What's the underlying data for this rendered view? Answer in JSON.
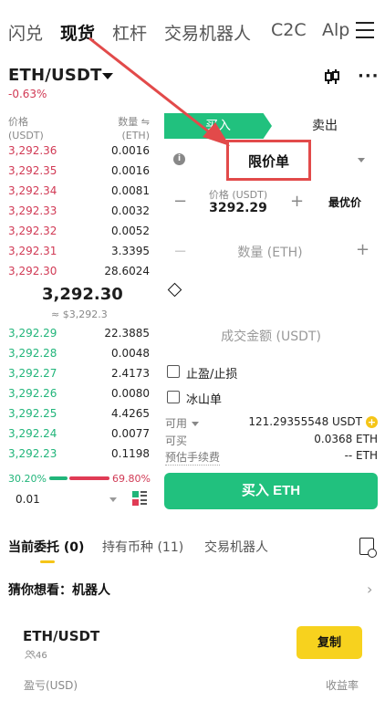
{
  "topnav": {
    "tabs": [
      {
        "label": "闪兑",
        "active": false
      },
      {
        "label": "现货",
        "active": true
      },
      {
        "label": "杠杆",
        "active": false
      },
      {
        "label": "交易机器人",
        "active": false
      },
      {
        "label": "C2C",
        "active": false
      },
      {
        "label": "Alp",
        "active": false
      }
    ],
    "menu_icon": "hamburger-menu-icon"
  },
  "pair": {
    "symbol": "ETH/USDT",
    "change": "-0.63%",
    "icons": [
      "candlestick-icon",
      "more-dots-icon"
    ]
  },
  "orderbook": {
    "price_header": "价格\n(USDT)",
    "price_header_line1": "价格",
    "price_header_line2": "(USDT)",
    "qty_header_line1": "数量 ⇋",
    "qty_header_line2": "(ETH)",
    "asks": [
      {
        "price": "3,292.36",
        "qty": "0.0016"
      },
      {
        "price": "3,292.35",
        "qty": "0.0016"
      },
      {
        "price": "3,292.34",
        "qty": "0.0081"
      },
      {
        "price": "3,292.33",
        "qty": "0.0032"
      },
      {
        "price": "3,292.32",
        "qty": "0.0052"
      },
      {
        "price": "3,292.31",
        "qty": "3.3395"
      },
      {
        "price": "3,292.30",
        "qty": "28.6024"
      }
    ],
    "last_price": "3,292.30",
    "last_price_usd": "≈ $3,292.3",
    "bids": [
      {
        "price": "3,292.29",
        "qty": "22.3885"
      },
      {
        "price": "3,292.28",
        "qty": "0.0048"
      },
      {
        "price": "3,292.27",
        "qty": "2.4173"
      },
      {
        "price": "3,292.26",
        "qty": "0.0080"
      },
      {
        "price": "3,292.25",
        "qty": "4.4265"
      },
      {
        "price": "3,292.24",
        "qty": "0.0077"
      },
      {
        "price": "3,292.23",
        "qty": "0.1198"
      }
    ],
    "buy_ratio": "30.20%",
    "sell_ratio": "69.80%",
    "precision": "0.01"
  },
  "order_form": {
    "buy_tab": "买入",
    "sell_tab": "卖出",
    "order_type": "限价单",
    "price_label": "价格 (USDT)",
    "price_value": "3292.29",
    "best_price": "最优价",
    "qty_placeholder": "数量 (ETH)",
    "amount_placeholder": "成交金额 (USDT)",
    "tp_sl": "止盈/止损",
    "iceberg": "冰山单",
    "available_label": "可用",
    "available_value": "121.29355548 USDT",
    "can_buy_label": "可买",
    "can_buy_value": "0.0368 ETH",
    "fee_label": "预估手续费",
    "fee_value": "-- ETH",
    "buy_button": "买入 ETH",
    "plus_sign": "+"
  },
  "bottom_tabs": {
    "tabs": [
      {
        "label": "当前委托 (0)",
        "active": true
      },
      {
        "label": "持有币种 (11)",
        "active": false
      },
      {
        "label": "交易机器人",
        "active": false
      }
    ]
  },
  "suggestion": {
    "title": "猜你想看：机器人",
    "arrow": "›"
  },
  "bot_card": {
    "pair": "ETH/USDT",
    "users": "46",
    "copy_button": "复制",
    "pnl_label": "盈亏(USD)",
    "roi_label": "收益率"
  },
  "colors": {
    "buy_green": "#21c17e",
    "sell_red": "#d13a55",
    "copy_yellow": "#f7d21e",
    "annotation_red": "#e24a4a"
  }
}
